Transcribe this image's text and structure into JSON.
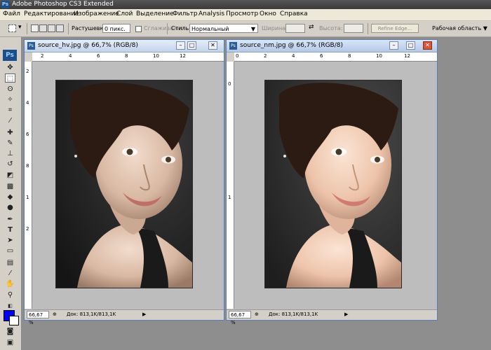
{
  "app": {
    "title": "Adobe Photoshop CS3 Extended",
    "logo": "Ps"
  },
  "menu": [
    "Файл",
    "Редактирование",
    "Изображение",
    "Слой",
    "Выделение",
    "Фильтр",
    "Analysis",
    "Просмотр",
    "Окно",
    "Справка"
  ],
  "options": {
    "feather_label": "Растушевка:",
    "feather_value": "0 пикс.",
    "antialias_label": "Сглаживание",
    "style_label": "Стиль:",
    "style_value": "Нормальный",
    "width_label": "Ширина:",
    "height_label": "Высота:",
    "refine_edge": "Refine Edge...",
    "workspace": "Рабочая область ▼"
  },
  "windows": [
    {
      "title": "source_hv.jpg @ 66,7% (RGB/8)",
      "zoom": "66,67 %",
      "doc_info": "Док: 813,1K/813,1K",
      "ruler_top_labels": [
        "2",
        "4",
        "6",
        "8",
        "10",
        "12"
      ],
      "ruler_left_labels": [
        "2",
        "4",
        "6",
        "8",
        "1",
        "2"
      ]
    },
    {
      "title": "source_nm.jpg @ 66,7% (RGB/8)",
      "zoom": "66,67 %",
      "doc_info": "Док: 813,1K/813,1K",
      "ruler_top_labels": [
        "0",
        "2",
        "4",
        "6",
        "8",
        "10",
        "12"
      ],
      "ruler_left_labels": [
        "0",
        "1"
      ]
    }
  ],
  "colors": {
    "foreground": "#0000f0",
    "background": "#ffffff",
    "accent": "#1c4f8a"
  }
}
